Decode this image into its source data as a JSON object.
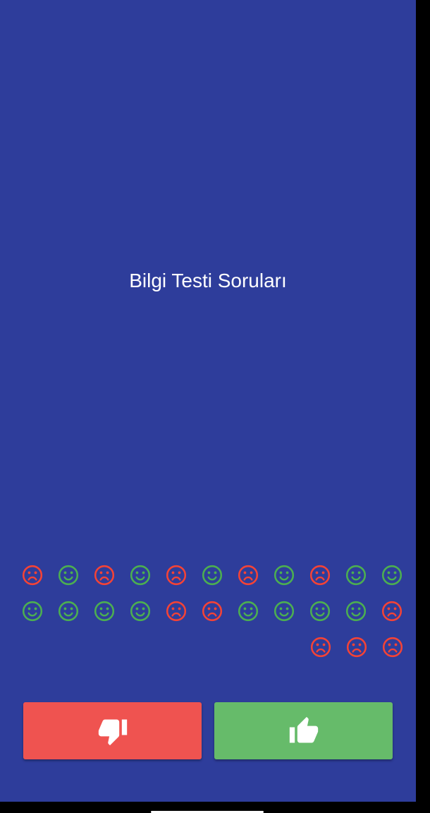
{
  "question": {
    "text": "Bilgi Testi Soruları"
  },
  "colors": {
    "background": "#2E3D9B",
    "correct": "#4CAF50",
    "wrong": "#F44336",
    "false_button": "#EF5350",
    "true_button": "#66BB6A"
  },
  "score_rows": [
    [
      "wrong",
      "correct",
      "wrong",
      "correct",
      "wrong",
      "correct",
      "wrong",
      "correct",
      "wrong",
      "correct",
      "correct"
    ],
    [
      "correct",
      "correct",
      "correct",
      "correct",
      "wrong",
      "wrong",
      "correct",
      "correct",
      "correct",
      "correct",
      "wrong"
    ],
    [
      "wrong",
      "wrong",
      "wrong"
    ]
  ],
  "buttons": {
    "false_icon": "thumb-down-icon",
    "true_icon": "thumb-up-icon"
  }
}
